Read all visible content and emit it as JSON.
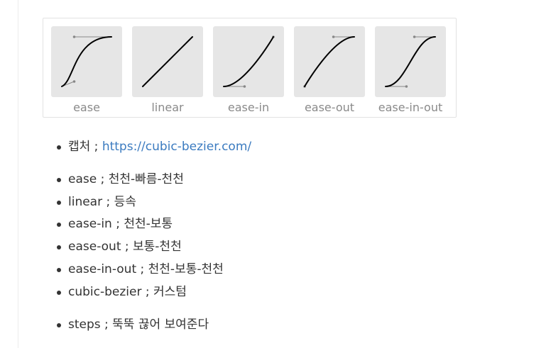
{
  "easing_panel": {
    "items": [
      {
        "label": "ease",
        "curve": [
          0.25,
          0.1,
          0.25,
          1.0
        ]
      },
      {
        "label": "linear",
        "curve": [
          0.0,
          0.0,
          1.0,
          1.0
        ]
      },
      {
        "label": "ease-in",
        "curve": [
          0.42,
          0.0,
          1.0,
          1.0
        ]
      },
      {
        "label": "ease-out",
        "curve": [
          0.0,
          0.0,
          0.58,
          1.0
        ]
      },
      {
        "label": "ease-in-out",
        "curve": [
          0.42,
          0.0,
          0.58,
          1.0
        ]
      }
    ],
    "colors": {
      "tile_background": "#e6e6e6",
      "curve_stroke": "#000000",
      "handle": "#888888"
    }
  },
  "capture_item": {
    "label": "캡처 ; ",
    "link_text": "https://cubic-bezier.com/"
  },
  "timing_items": [
    {
      "text": "ease ; 천천-빠름-천천"
    },
    {
      "text": "linear ; 등속"
    },
    {
      "text": "ease-in ; 천천-보통"
    },
    {
      "text": "ease-out ; 보통-천천"
    },
    {
      "text": "ease-in-out ; 천천-보통-천천"
    },
    {
      "text": "cubic-bezier ; 커스텀"
    }
  ],
  "steps_item": {
    "text": "steps ; 뚝뚝 끊어 보여준다"
  }
}
